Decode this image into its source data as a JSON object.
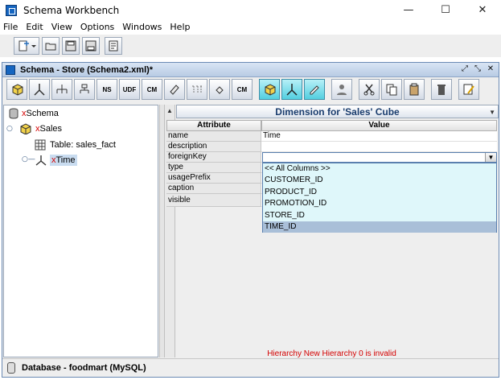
{
  "window": {
    "title": "Schema Workbench",
    "controls": {
      "minimize": "—",
      "maximize": "☐",
      "close": "✕"
    }
  },
  "menu": [
    "File",
    "Edit",
    "View",
    "Options",
    "Windows",
    "Help"
  ],
  "main_toolbar": {
    "icons": [
      "new-file-dropdown-icon",
      "open-icon",
      "save-icon",
      "save-as-icon",
      "preferences-icon"
    ]
  },
  "schema_frame": {
    "title": "Schema - Store (Schema2.xml)*",
    "controls": [
      "⤢",
      "⤡",
      "✕"
    ],
    "toolbar": [
      {
        "label": "",
        "icon": "add-cube-icon"
      },
      {
        "label": "",
        "icon": "add-dimension-icon"
      },
      {
        "label": "",
        "icon": "add-hierarchy-icon"
      },
      {
        "label": "",
        "icon": "add-level-icon"
      },
      {
        "label": "NS",
        "icon": "add-named-set-icon"
      },
      {
        "label": "UDF",
        "icon": "add-udf-icon"
      },
      {
        "label": "CM",
        "icon": "add-calculated-member-icon"
      },
      {
        "label": "",
        "icon": "add-measure-icon"
      },
      {
        "label": "",
        "icon": "add-virtual-cube-icon"
      },
      {
        "label": "",
        "icon": "add-property-icon"
      },
      {
        "label": "CM",
        "icon": "add-virtual-calc-member-icon"
      },
      {
        "label": "",
        "icon": "cube-highlight-icon",
        "highlight": true
      },
      {
        "label": "",
        "icon": "dimension-highlight-icon",
        "highlight": true
      },
      {
        "label": "",
        "icon": "edit-highlight-icon",
        "highlight": true
      },
      {
        "label": "",
        "icon": "add-role-icon"
      },
      {
        "label": "",
        "icon": "cut-icon"
      },
      {
        "label": "",
        "icon": "copy-icon"
      },
      {
        "label": "",
        "icon": "paste-icon"
      },
      {
        "label": "",
        "icon": "delete-icon"
      },
      {
        "label": "",
        "icon": "edit-icon"
      }
    ]
  },
  "tree": [
    {
      "prefix": "x",
      "label": "Schema",
      "icon": "schema-icon"
    },
    {
      "prefix": "x",
      "label": "Sales",
      "icon": "cube-icon"
    },
    {
      "prefix": "",
      "label": "Table: sales_fact",
      "icon": "table-icon"
    },
    {
      "prefix": "x",
      "label": "Time",
      "icon": "dimension-icon",
      "selected": true
    }
  ],
  "detail": {
    "header": "Dimension for 'Sales' Cube",
    "col_attribute": "Attribute",
    "col_value": "Value",
    "rows": [
      {
        "key": "name",
        "value": "Time"
      },
      {
        "key": "description",
        "value": ""
      },
      {
        "key": "foreignKey",
        "value": ""
      },
      {
        "key": "type",
        "value": ""
      },
      {
        "key": "usagePrefix",
        "value": ""
      },
      {
        "key": "caption",
        "value": ""
      },
      {
        "key": "visible",
        "value": ""
      }
    ],
    "dropdown_options": [
      "<< All Columns >>",
      "CUSTOMER_ID",
      "PRODUCT_ID",
      "PROMOTION_ID",
      "STORE_ID",
      "TIME_ID"
    ],
    "dropdown_selected": "TIME_ID",
    "error": "Hierarchy New Hierarchy 0 is invalid"
  },
  "status": "Database - foodmart (MySQL)"
}
